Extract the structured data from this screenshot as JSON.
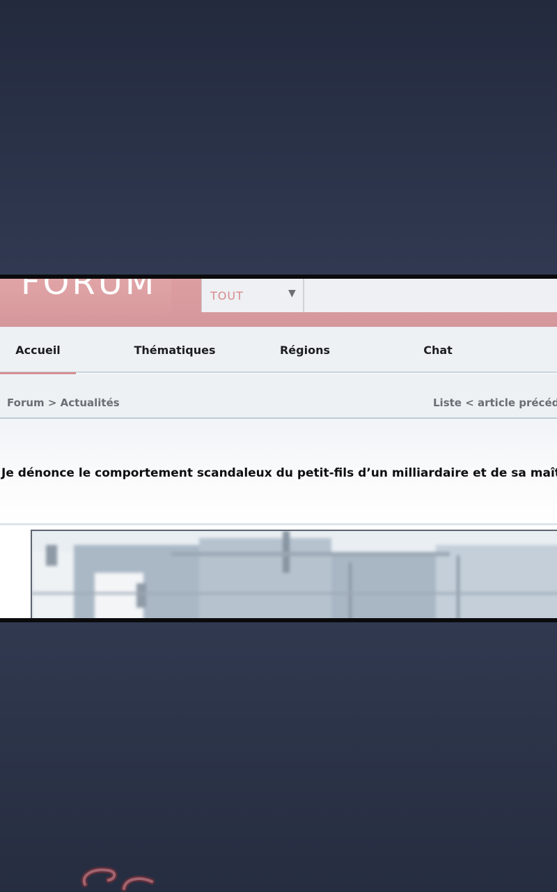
{
  "header": {
    "logo_text": "FORUM",
    "search_select": {
      "value": "TOUT",
      "arrow": "▼"
    }
  },
  "nav": {
    "tabs": [
      {
        "label": "Accueil",
        "active": true
      },
      {
        "label": "Thématiques",
        "active": false
      },
      {
        "label": "Régions",
        "active": false
      },
      {
        "label": "Chat",
        "active": false
      }
    ]
  },
  "breadcrumb": "Forum > Actualités",
  "prev_link": "Liste < article précéden",
  "article": {
    "title": "Je dénonce le comportement scandaleux du petit-fils d’un milliardaire et de sa maîtresse."
  },
  "colors": {
    "header_pink": "#d4979b",
    "accent_pink": "#d58e92",
    "background_navy": "#313a52"
  }
}
